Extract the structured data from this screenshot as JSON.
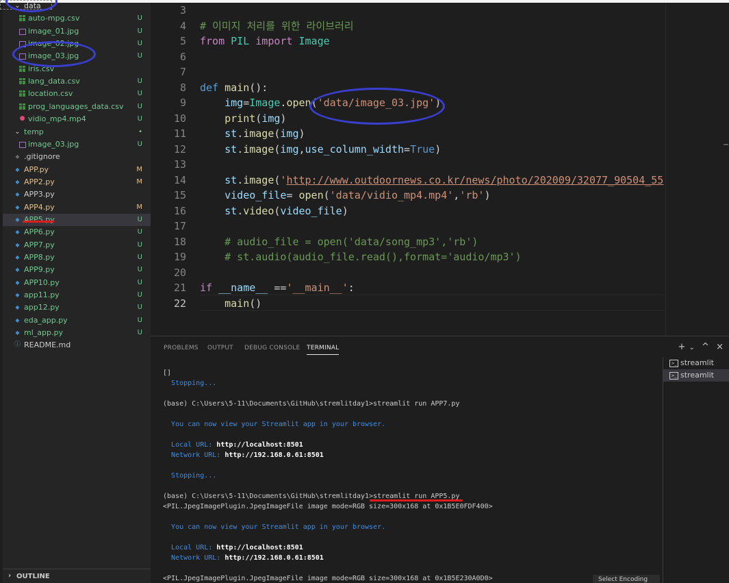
{
  "explorer": {
    "items": [
      {
        "label": "data",
        "type": "folder",
        "open": true,
        "color": "#cccccc",
        "status": "",
        "status_color": ""
      },
      {
        "label": "auto-mpg.csv",
        "type": "csv",
        "color": "#73c991",
        "status": "U",
        "status_color": "#73c991"
      },
      {
        "label": "image_01.jpg",
        "type": "img",
        "color": "#73c991",
        "status": "U",
        "status_color": "#73c991"
      },
      {
        "label": "image_02.jpg",
        "type": "img",
        "color": "#73c991",
        "status": "U",
        "status_color": "#73c991"
      },
      {
        "label": "image_03.jpg",
        "type": "img",
        "color": "#73c991",
        "status": "U",
        "status_color": "#73c991"
      },
      {
        "label": "iris.csv",
        "type": "csv",
        "color": "#73c991",
        "status": "",
        "status_color": ""
      },
      {
        "label": "lang_data.csv",
        "type": "csv",
        "color": "#73c991",
        "status": "U",
        "status_color": "#73c991"
      },
      {
        "label": "location.csv",
        "type": "csv",
        "color": "#73c991",
        "status": "U",
        "status_color": "#73c991"
      },
      {
        "label": "prog_languages_data.csv",
        "type": "csv",
        "color": "#73c991",
        "status": "U",
        "status_color": "#73c991"
      },
      {
        "label": "vidio_mp4.mp4",
        "type": "video",
        "color": "#73c991",
        "status": "U",
        "status_color": "#73c991"
      },
      {
        "label": "temp",
        "type": "folder",
        "open": true,
        "color": "#73c991",
        "status": "•",
        "status_color": "#73c991"
      },
      {
        "label": "image_03.jpg",
        "type": "img",
        "color": "#73c991",
        "status": "U",
        "status_color": "#73c991"
      },
      {
        "label": ".gitignore",
        "type": "git",
        "color": "#cccccc",
        "status": "",
        "status_color": ""
      },
      {
        "label": "APP.py",
        "type": "py",
        "color": "#e2c08d",
        "status": "M",
        "status_color": "#e2c08d"
      },
      {
        "label": "APP2.py",
        "type": "py",
        "color": "#e2c08d",
        "status": "M",
        "status_color": "#e2c08d"
      },
      {
        "label": "APP3.py",
        "type": "py",
        "color": "#cccccc",
        "status": "",
        "status_color": ""
      },
      {
        "label": "APP4.py",
        "type": "py",
        "color": "#e2c08d",
        "status": "M",
        "status_color": "#e2c08d"
      },
      {
        "label": "APP5.py",
        "type": "py",
        "color": "#73c991",
        "status": "U",
        "status_color": "#73c991"
      },
      {
        "label": "APP6.py",
        "type": "py",
        "color": "#73c991",
        "status": "U",
        "status_color": "#73c991"
      },
      {
        "label": "APP7.py",
        "type": "py",
        "color": "#73c991",
        "status": "U",
        "status_color": "#73c991"
      },
      {
        "label": "APP8.py",
        "type": "py",
        "color": "#73c991",
        "status": "U",
        "status_color": "#73c991"
      },
      {
        "label": "APP9.py",
        "type": "py",
        "color": "#73c991",
        "status": "U",
        "status_color": "#73c991"
      },
      {
        "label": "APP10.py",
        "type": "py",
        "color": "#73c991",
        "status": "U",
        "status_color": "#73c991"
      },
      {
        "label": "app11.py",
        "type": "py",
        "color": "#73c991",
        "status": "U",
        "status_color": "#73c991"
      },
      {
        "label": "app12.py",
        "type": "py",
        "color": "#73c991",
        "status": "U",
        "status_color": "#73c991"
      },
      {
        "label": "eda_app.py",
        "type": "py",
        "color": "#73c991",
        "status": "U",
        "status_color": "#73c991"
      },
      {
        "label": "ml_app.py",
        "type": "py",
        "color": "#73c991",
        "status": "U",
        "status_color": "#73c991"
      },
      {
        "label": "README.md",
        "type": "info",
        "color": "#cccccc",
        "status": "",
        "status_color": ""
      }
    ],
    "outline_label": "OUTLINE"
  },
  "editor": {
    "lines": [
      {
        "n": "3",
        "html": ""
      },
      {
        "n": "4",
        "html": "<span class=\"cm\"># 이미지 처리를 위한 라이브러리</span>"
      },
      {
        "n": "5",
        "html": "<span class=\"kw2\">from</span> <span class=\"cls\">PIL</span> <span class=\"kw2\">import</span> <span class=\"cls\">Image</span>"
      },
      {
        "n": "6",
        "html": ""
      },
      {
        "n": "7",
        "html": ""
      },
      {
        "n": "8",
        "html": "<span class=\"kw\">def</span> <span class=\"fn\">main</span>():"
      },
      {
        "n": "9",
        "html": "    <span class=\"var\">img</span>=<span class=\"cls\">Image</span>.<span class=\"fn\">open</span>(<span class=\"str\">'data/image_03.jpg'</span>)"
      },
      {
        "n": "10",
        "html": "    <span class=\"fn\">print</span>(<span class=\"var\">img</span>)"
      },
      {
        "n": "11",
        "html": "    <span class=\"var\">st</span>.<span class=\"fn\">image</span>(<span class=\"var\">img</span>)"
      },
      {
        "n": "12",
        "html": "    <span class=\"var\">st</span>.<span class=\"fn\">image</span>(<span class=\"var\">img</span>,<span class=\"var\">use_column_width</span>=<span class=\"kw\">True</span>)"
      },
      {
        "n": "13",
        "html": ""
      },
      {
        "n": "14",
        "html": "    <span class=\"var\">st</span>.<span class=\"fn\">image</span>(<span class=\"str\">'</span><span class=\"lnk\">http://www.outdoornews.co.kr/news/photo/202009/32077_90504_55</span>"
      },
      {
        "n": "15",
        "html": "    <span class=\"var\">video_file</span>= <span class=\"fn\">open</span>(<span class=\"str\">'data/vidio_mp4.mp4'</span>,<span class=\"str\">'rb'</span>)"
      },
      {
        "n": "16",
        "html": "    <span class=\"var\">st</span>.<span class=\"fn\">video</span>(<span class=\"var\">video_file</span>)"
      },
      {
        "n": "17",
        "html": ""
      },
      {
        "n": "18",
        "html": "    <span class=\"cm\"># audio_file = open('data/song_mp3','rb')</span>"
      },
      {
        "n": "19",
        "html": "    <span class=\"cm\"># st.audio(audio_file.read(),format='audio/mp3')</span>"
      },
      {
        "n": "20",
        "html": ""
      },
      {
        "n": "21",
        "html": "<span class=\"kw2\">if</span> <span class=\"var\">__name__</span> ==<span class=\"str\">'__main__'</span>:"
      },
      {
        "n": "22",
        "html": "    <span class=\"fn\">main</span>()"
      }
    ]
  },
  "panel": {
    "tabs": [
      "PROBLEMS",
      "OUTPUT",
      "DEBUG CONSOLE",
      "TERMINAL"
    ],
    "active_tab": "TERMINAL",
    "actions": [
      "+",
      "⌄",
      "^",
      "×"
    ],
    "terminal_list": [
      {
        "label": "streamlit",
        "selected": false
      },
      {
        "label": "streamlit",
        "selected": true
      }
    ],
    "terminal_lines": [
      {
        "html": "[]"
      },
      {
        "html": "  <span class=\"cy\">Stopping...</span>"
      },
      {
        "html": ""
      },
      {
        "html": "(base) C:\\Users\\5-11\\Documents\\GitHub\\stremlitday1>streamlit run APP7.py"
      },
      {
        "html": ""
      },
      {
        "html": "  <span class=\"cy\">You can now view your Streamlit app in your browser.</span>"
      },
      {
        "html": ""
      },
      {
        "html": "  <span class=\"cy\">Local URL:</span> <span class=\"bold\">http://localhost:8501</span>"
      },
      {
        "html": "  <span class=\"cy\">Network URL:</span> <span class=\"bold\">http://192.168.0.61:8501</span>"
      },
      {
        "html": ""
      },
      {
        "html": "  <span class=\"cy\">Stopping...</span>"
      },
      {
        "html": ""
      },
      {
        "html": "(base) C:\\Users\\5-11\\Documents\\GitHub\\stremlitday1>streamlit run APP5.py"
      },
      {
        "html": "&lt;PIL.JpegImagePlugin.JpegImageFile image mode=RGB size=300x168 at 0x1B5E0FDF400&gt;"
      },
      {
        "html": ""
      },
      {
        "html": "  <span class=\"cy\">You can now view your Streamlit app in your browser.</span>"
      },
      {
        "html": ""
      },
      {
        "html": "  <span class=\"cy\">Local URL:</span> <span class=\"bold\">http://localhost:8501</span>"
      },
      {
        "html": "  <span class=\"cy\">Network URL:</span> <span class=\"bold\">http://192.168.0.61:8501</span>"
      },
      {
        "html": ""
      },
      {
        "html": "&lt;PIL.JpegImagePlugin.JpegImageFile image mode=RGB size=300x168 at 0x1B5E230A0D0&gt;"
      }
    ],
    "encoding_label": "Select Encoding"
  },
  "colors": {
    "annotation_ellipse": "#3a3fcf",
    "annotation_underline": "#e01b1b"
  }
}
